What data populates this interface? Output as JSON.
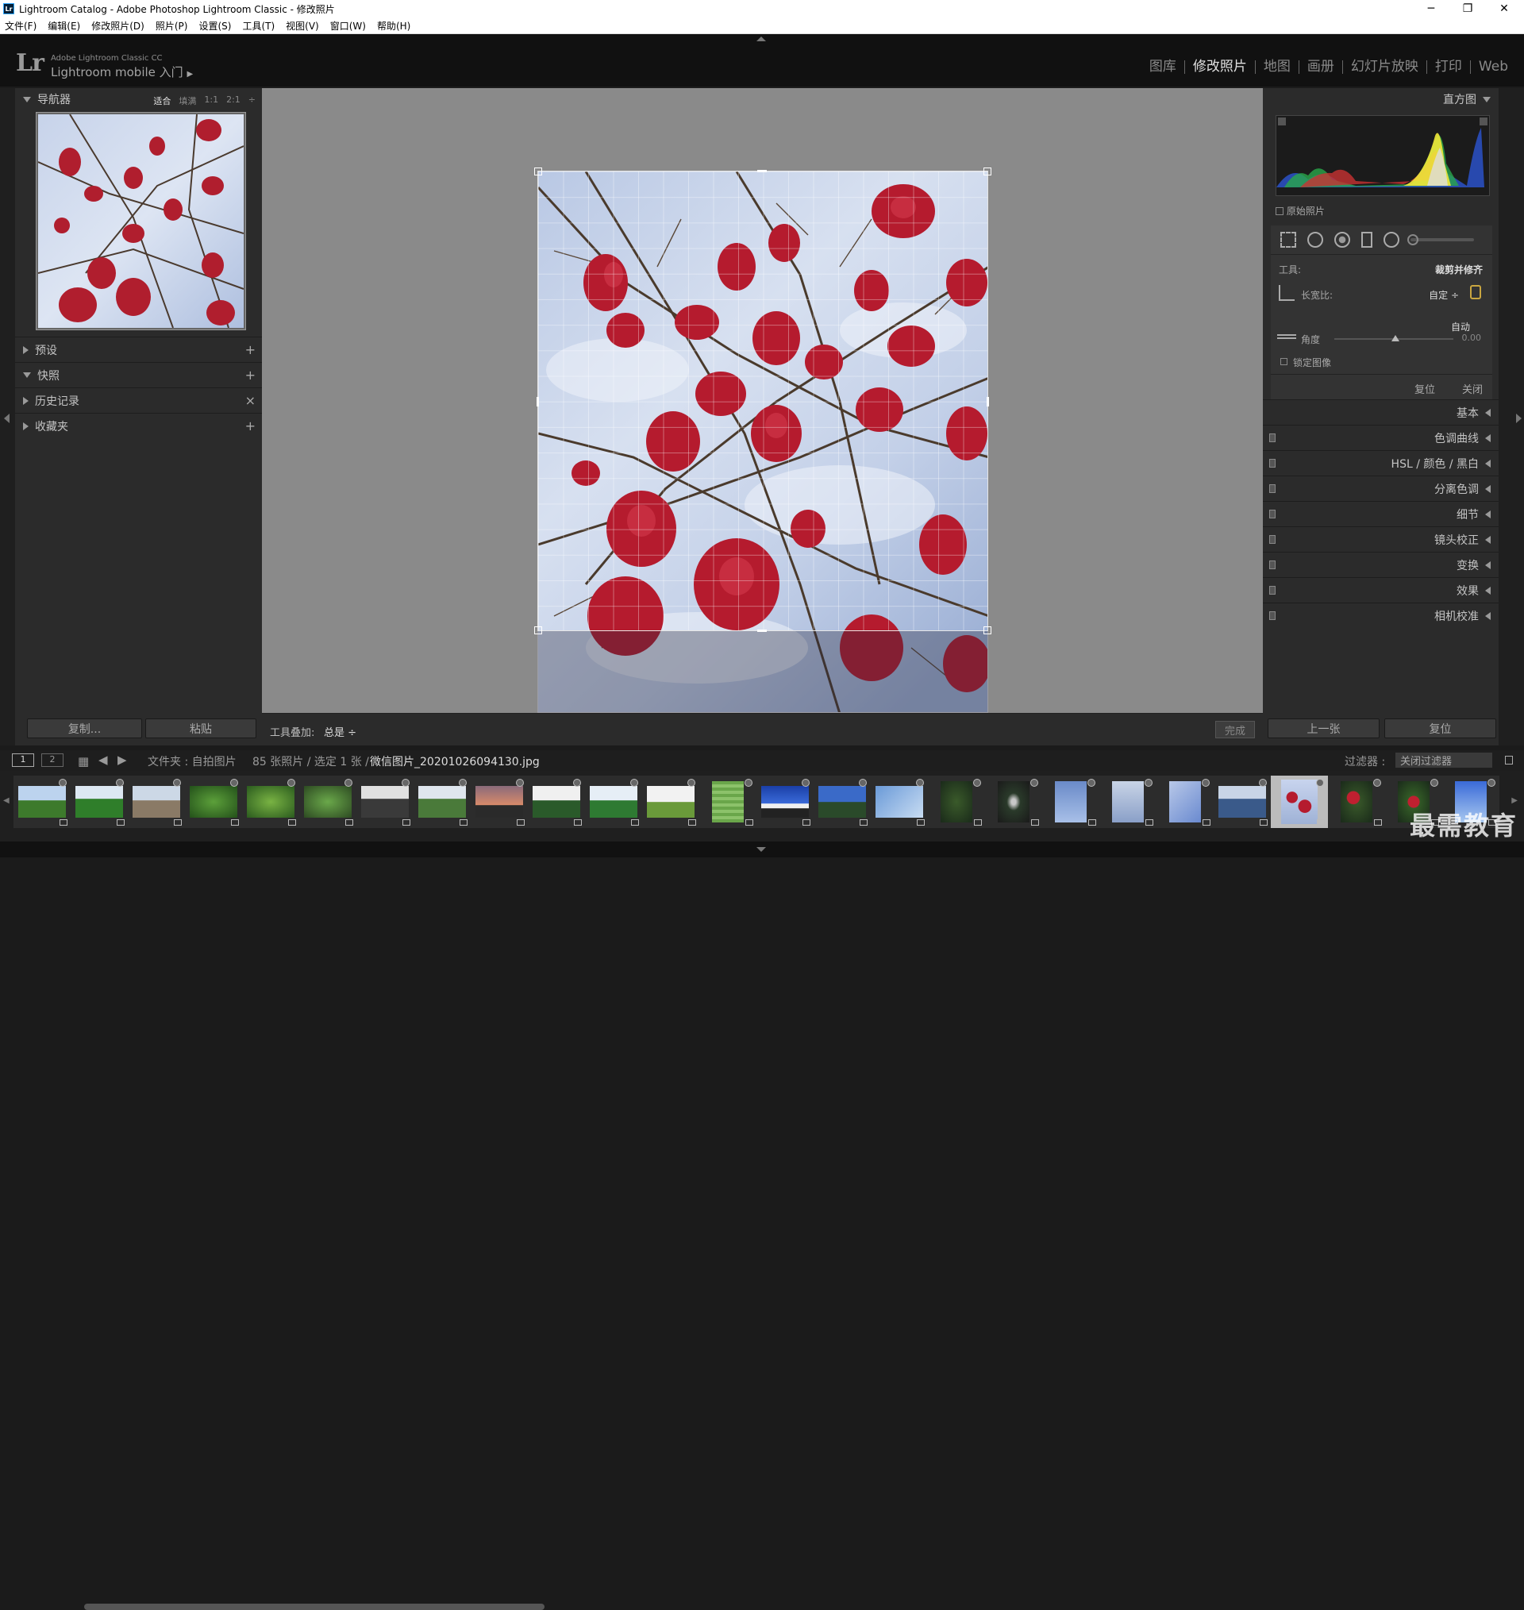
{
  "window": {
    "title": "Lightroom Catalog - Adobe Photoshop Lightroom Classic - 修改照片",
    "app_icon": "Lr"
  },
  "menu": [
    "文件(F)",
    "编辑(E)",
    "修改照片(D)",
    "照片(P)",
    "设置(S)",
    "工具(T)",
    "视图(V)",
    "窗口(W)",
    "帮助(H)"
  ],
  "identity": {
    "logo": "Lr",
    "product": "Adobe Lightroom Classic CC",
    "mobile": "Lightroom mobile 入门"
  },
  "modules": [
    "图库",
    "修改照片",
    "地图",
    "画册",
    "幻灯片放映",
    "打印",
    "Web"
  ],
  "active_module": "修改照片",
  "navigator": {
    "title": "导航器",
    "options": [
      "适合",
      "填满",
      "1:1",
      "2:1"
    ],
    "selected": "适合"
  },
  "left_sections": [
    {
      "label": "预设",
      "action": "+"
    },
    {
      "label": "快照",
      "action": "+"
    },
    {
      "label": "历史记录",
      "action": "×"
    },
    {
      "label": "收藏夹",
      "action": "+"
    }
  ],
  "left_buttons": {
    "copy": "复制...",
    "paste": "粘贴"
  },
  "toolbar": {
    "overlay_label": "工具叠加:",
    "overlay_value": "总是 ÷",
    "done": "完成"
  },
  "histogram": {
    "title": "直方图",
    "original": "原始照片"
  },
  "crop": {
    "tool_label": "工具:",
    "tool_name": "裁剪并修齐",
    "aspect_label": "长宽比:",
    "aspect_value": "自定 ÷",
    "auto": "自动",
    "angle_label": "角度",
    "angle_value": "0.00",
    "lock_label": "锁定图像",
    "reset": "复位",
    "close": "关闭"
  },
  "right_sections": [
    "基本",
    "色调曲线",
    "HSL / 颜色 / 黑白",
    "分离色调",
    "细节",
    "镜头校正",
    "变换",
    "效果",
    "相机校准"
  ],
  "right_buttons": {
    "prev": "上一张",
    "reset": "复位"
  },
  "filmstrip": {
    "page1": "1",
    "page2": "2",
    "path": "文件夹 : 自拍图片",
    "count": "85 张照片 / 选定 1 张 /",
    "filename": "微信图片_20201026094130.jpg",
    "filter_label": "过滤器 :",
    "filter_value": "关闭过滤器"
  },
  "watermark": "最需教育",
  "colors": {
    "accent": "#e0e0e0",
    "panel": "#2b2b2b",
    "canvas": "#8a8a8a"
  }
}
